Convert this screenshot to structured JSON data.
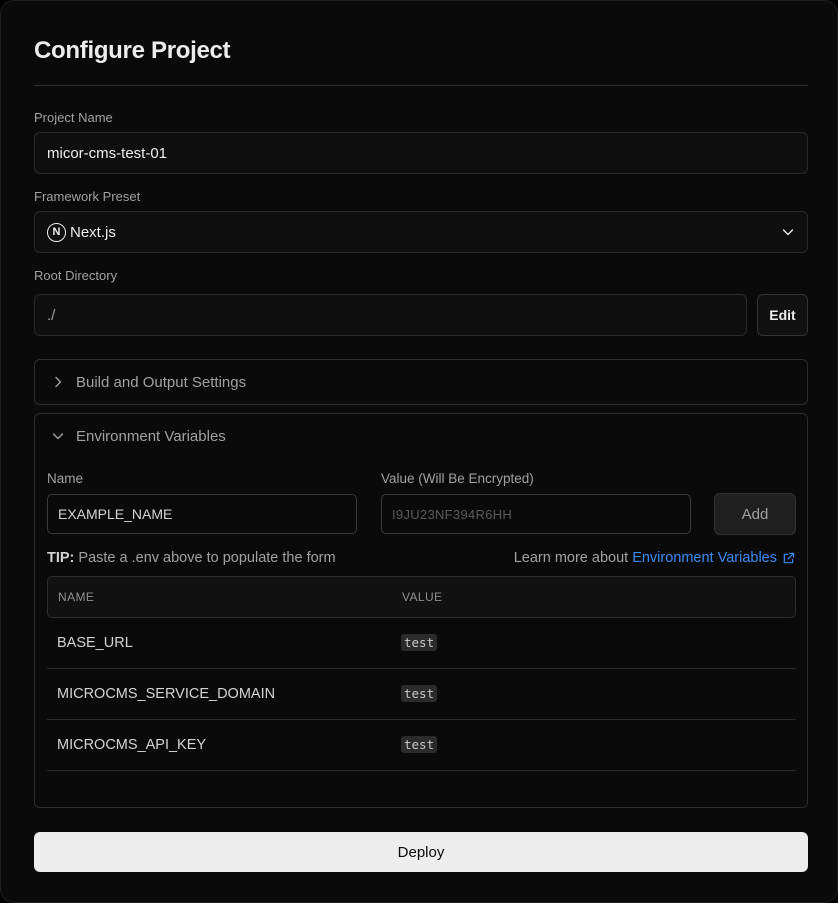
{
  "title": "Configure Project",
  "project_name": {
    "label": "Project Name",
    "value": "micor-cms-test-01"
  },
  "framework": {
    "label": "Framework Preset",
    "icon_letter": "N",
    "value": "Next.js"
  },
  "root_dir": {
    "label": "Root Directory",
    "value": "./",
    "edit_label": "Edit"
  },
  "build_section": {
    "label": "Build and Output Settings",
    "expanded": false
  },
  "env_section": {
    "label": "Environment Variables",
    "expanded": true,
    "name_label": "Name",
    "name_value": "EXAMPLE_NAME",
    "value_label": "Value (Will Be Encrypted)",
    "value_placeholder": "I9JU23NF394R6HH",
    "add_label": "Add",
    "tip_prefix": "TIP:",
    "tip_text": "Paste a .env above to populate the form",
    "learn_text": "Learn more about",
    "learn_link": "Environment Variables",
    "table": {
      "headers": [
        "NAME",
        "VALUE"
      ],
      "rows": [
        {
          "name": "BASE_URL",
          "value": "test"
        },
        {
          "name": "MICROCMS_SERVICE_DOMAIN",
          "value": "test"
        },
        {
          "name": "MICROCMS_API_KEY",
          "value": "test"
        }
      ]
    }
  },
  "deploy_label": "Deploy",
  "colors": {
    "background": "#0a0a0a",
    "link": "#3b8bf5",
    "deploy_bg": "#ededed"
  }
}
